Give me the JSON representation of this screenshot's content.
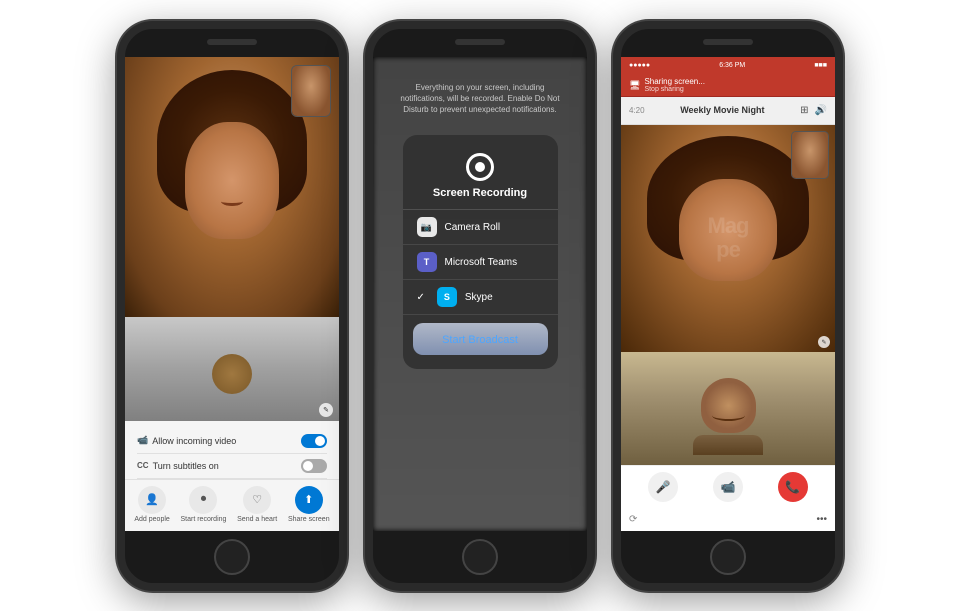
{
  "page": {
    "bg_color": "#ffffff"
  },
  "phone1": {
    "toggles": [
      {
        "label": "Allow incoming video",
        "icon": "📹",
        "state": "on"
      },
      {
        "label": "Turn subtitles on",
        "icon": "CC",
        "state": "off"
      }
    ],
    "actions": [
      {
        "label": "Add people",
        "icon": "👤+"
      },
      {
        "label": "Start recording",
        "icon": "⏺"
      },
      {
        "label": "Send a heart",
        "icon": "♡"
      },
      {
        "label": "Share screen",
        "icon": "⬆",
        "active": true
      }
    ]
  },
  "phone2": {
    "hint": "Everything on your screen, including notifications, will be recorded. Enable Do Not Disturb to prevent unexpected notifications.",
    "popup_title": "Screen Recording",
    "items": [
      {
        "label": "Camera Roll",
        "type": "camera",
        "icon": "📷",
        "checked": false
      },
      {
        "label": "Microsoft Teams",
        "type": "teams",
        "icon": "T",
        "checked": false
      },
      {
        "label": "Skype",
        "type": "skype",
        "icon": "S",
        "checked": true
      }
    ],
    "start_label": "Start",
    "broadcast_label": "Broadcast"
  },
  "phone3": {
    "status_bar": {
      "signal": "●●●●●",
      "time": "6:36 PM",
      "battery": "■■■"
    },
    "share_bar": {
      "sharing_text": "Sharing screen...",
      "stop_text": "Stop sharing"
    },
    "call_header": {
      "title": "Weekly Movie Night",
      "time": "4:20"
    },
    "controls": [
      {
        "label": "mic",
        "icon": "🎤",
        "type": "mic"
      },
      {
        "label": "camera",
        "icon": "📹",
        "type": "cam"
      },
      {
        "label": "end",
        "icon": "📞",
        "type": "end"
      }
    ],
    "watermark": "Mag\npe"
  }
}
